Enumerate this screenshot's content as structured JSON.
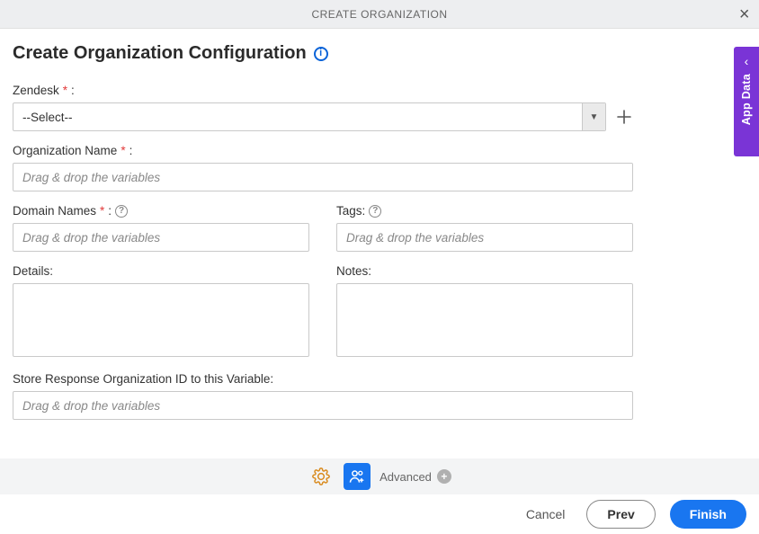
{
  "header": {
    "title": "CREATE ORGANIZATION"
  },
  "page": {
    "title": "Create Organization Configuration"
  },
  "sideTab": {
    "label": "App Data"
  },
  "fields": {
    "zendesk": {
      "label": "Zendesk",
      "selected": "--Select--"
    },
    "orgName": {
      "label": "Organization Name",
      "placeholder": "Drag & drop the variables"
    },
    "domainNames": {
      "label": "Domain Names",
      "placeholder": "Drag & drop the variables"
    },
    "tags": {
      "label": "Tags:",
      "placeholder": "Drag & drop the variables"
    },
    "details": {
      "label": "Details:"
    },
    "notes": {
      "label": "Notes:"
    },
    "storeResponse": {
      "label": "Store Response Organization ID to this Variable:",
      "placeholder": "Drag & drop the variables"
    }
  },
  "toolbar": {
    "advanced": "Advanced"
  },
  "footer": {
    "cancel": "Cancel",
    "prev": "Prev",
    "finish": "Finish"
  }
}
